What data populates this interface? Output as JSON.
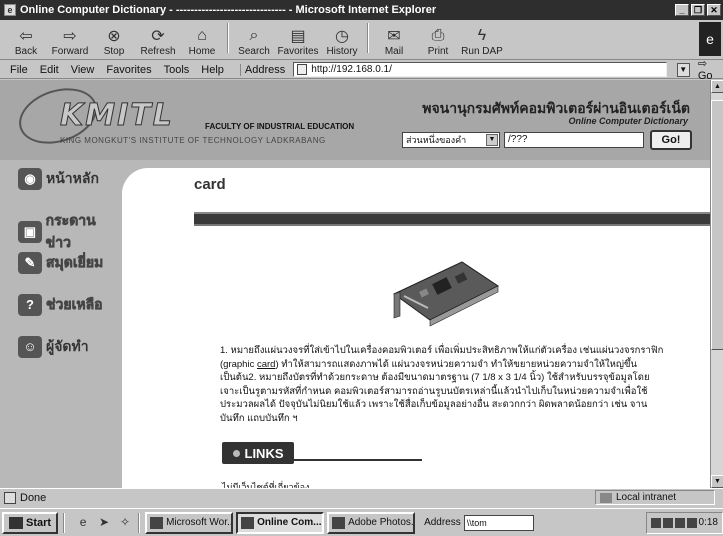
{
  "window": {
    "title": "Online Computer Dictionary - ------------------------------ - Microsoft Internet Explorer"
  },
  "toolbar": {
    "buttons": [
      {
        "label": "Back",
        "icon": "back-arrow-icon"
      },
      {
        "label": "Forward",
        "icon": "forward-arrow-icon"
      },
      {
        "label": "Stop",
        "icon": "stop-icon"
      },
      {
        "label": "Refresh",
        "icon": "refresh-icon"
      },
      {
        "label": "Home",
        "icon": "home-icon"
      },
      {
        "label": "Search",
        "icon": "search-icon"
      },
      {
        "label": "Favorites",
        "icon": "favorites-icon"
      },
      {
        "label": "History",
        "icon": "history-icon"
      },
      {
        "label": "Mail",
        "icon": "mail-icon"
      },
      {
        "label": "Print",
        "icon": "print-icon"
      },
      {
        "label": "Run DAP",
        "icon": "run-dap-icon"
      }
    ]
  },
  "menubar": {
    "items": [
      "File",
      "Edit",
      "View",
      "Favorites",
      "Tools",
      "Help"
    ],
    "address_label": "Address",
    "address_value": "http://192.168.0.1/",
    "go_label": "Go"
  },
  "site": {
    "logo_text": "KMITL",
    "faculty": "FACULTY OF INDUSTRIAL EDUCATION",
    "institute": "KING MONGKUT'S INSTITUTE OF TECHNOLOGY LADKRABANG",
    "title_thai": "พจนานุกรมศัพท์คอมพิวเตอร์ผ่านอินเตอร์เน็ต",
    "subtitle": "Online Computer Dictionary",
    "search_mode": "ส่วนหนึ่งของคำ",
    "search_value": "/???",
    "go_button": "Go!"
  },
  "nav": {
    "items": [
      {
        "label": "หน้าหลัก",
        "icon": "home-icon"
      },
      {
        "label": "กระดานข่าว",
        "icon": "bulletin-board-icon"
      },
      {
        "label": "สมุดเยี่ยม",
        "icon": "guestbook-icon"
      },
      {
        "label": "ช่วยเหลือ",
        "icon": "help-icon"
      },
      {
        "label": "ผู้จัดทำ",
        "icon": "authors-icon"
      }
    ]
  },
  "entry": {
    "word": "card",
    "definition_pre": "1. หมายถึงแผ่นวงจรที่ใส่เข้าไปในเครื่องคอมพิวเตอร์ เพื่อเพิ่มประสิทธิภาพให้แก่ตัวเครื่อง เช่นแผ่นวงจรกราฟิก (graphic ",
    "definition_link": "card",
    "definition_post": ") ทำให้สามารถแสดงภาพได้ แผ่นวงจรหน่วยความจำ ทำให้ขยายหน่วยความจำให้ใหญ่ขึ้น เป็นต้น2. หมายถึงบัตรที่ทำด้วยกระดาษ ต้องมีขนาดมาตรฐาน (7 1/8 x 3 1/4 นิ้ว) ใช้สำหรับบรรจุข้อมูลโดยเจาะเป็นรูตามรหัสที่กำหนด คอมพิวเตอร์สามารถอ่านรูบนบัตรเหล่านี้แล้วนำไปเก็บในหน่วยความจำเพื่อใช้ประมวลผลได้ ปัจจุบันไม่นิยมใช้แล้ว เพราะใช้สื่อเก็บข้อมูลอย่างอื่น สะดวกกว่า ผิดพลาดน้อยกว่า เช่น จานบันทึก แถบบันทึก ฯ",
    "links_header": "LINKS",
    "no_links": "ไม่มีเว็บไซต์ที่เกี่ยวข้อง"
  },
  "statusbar": {
    "status": "Done",
    "zone": "Local intranet"
  },
  "taskbar": {
    "start": "Start",
    "tasks": [
      {
        "label": "Microsoft Wor...",
        "active": false
      },
      {
        "label": "Online Com...",
        "active": true
      },
      {
        "label": "Adobe Photos...",
        "active": false
      }
    ],
    "address_label": "Address",
    "address_value": "\\\\tom",
    "clock": "0:18"
  },
  "colors": {
    "page_background": "#b8b8b8",
    "header_background": "#a7a7a7",
    "content_background": "#ffffff",
    "title_bar": "#3a3a3a"
  }
}
